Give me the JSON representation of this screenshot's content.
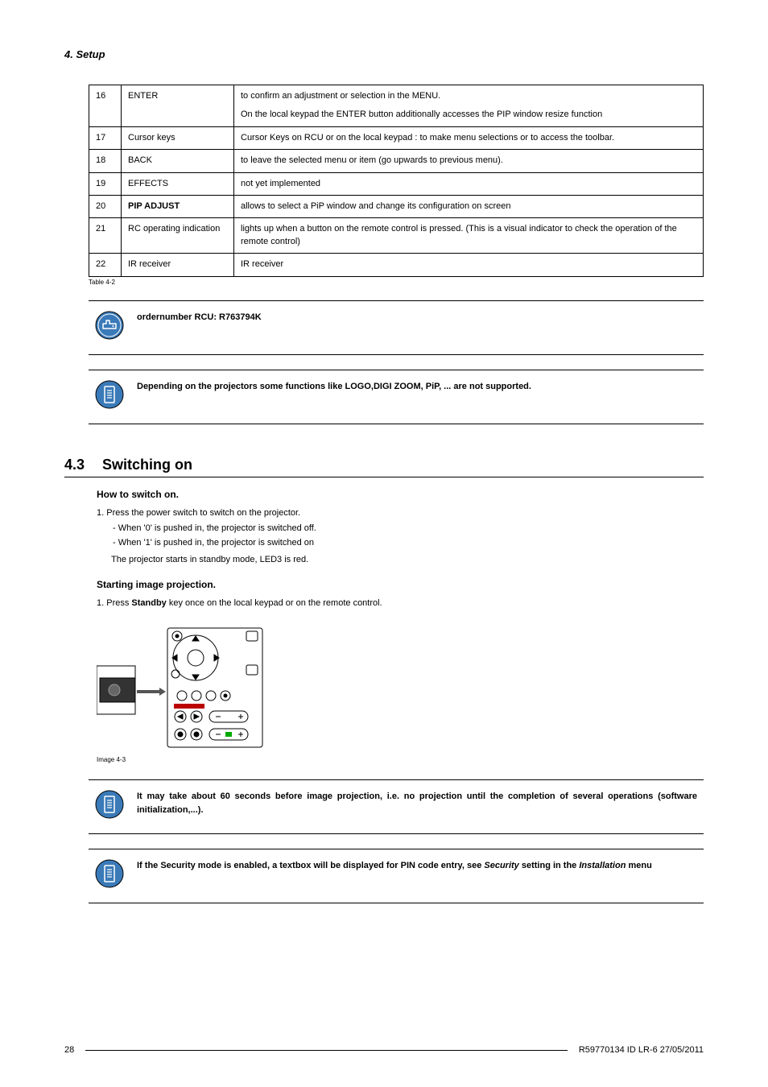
{
  "header": {
    "chapter": "4.  Setup"
  },
  "table": {
    "rows": [
      {
        "num": "16",
        "name": "ENTER",
        "bold": false,
        "desc": "to confirm an adjustment or selection in the MENU.\nOn the local keypad the ENTER button additionally accesses the PIP window resize function"
      },
      {
        "num": "17",
        "name": "Cursor keys",
        "bold": false,
        "desc": "Cursor Keys on RCU or on the local keypad : to make menu selections or to access the toolbar."
      },
      {
        "num": "18",
        "name": "BACK",
        "bold": false,
        "desc": "to leave the selected menu or item (go upwards to previous menu)."
      },
      {
        "num": "19",
        "name": "EFFECTS",
        "bold": false,
        "desc": "not yet implemented"
      },
      {
        "num": "20",
        "name": "PIP ADJUST",
        "bold": true,
        "desc": "allows to select a PiP window and change its configuration on screen"
      },
      {
        "num": "21",
        "name": "RC operating indication",
        "bold": false,
        "desc": "lights up when a button on the remote control is pressed.  (This is a visual indicator to check the operation of the remote control)"
      },
      {
        "num": "22",
        "name": "IR receiver",
        "bold": false,
        "desc": "IR receiver"
      }
    ],
    "caption": "Table 4-2"
  },
  "callouts": {
    "order": "ordernumber RCU: R763794K",
    "unsupported": "Depending on the projectors some functions like LOGO,DIGI ZOOM, PiP, ...  are not supported.",
    "delay": "It may take about 60 seconds before image projection, i.e. no projection until the completion of several operations (software initialization,...).",
    "security_pre": "If the Security mode is enabled, a textbox will be displayed for PIN code entry, see ",
    "security_italic1": "Security",
    "security_mid": " setting in the ",
    "security_italic2": "Installation",
    "security_post": " menu"
  },
  "section": {
    "number": "4.3",
    "title": "Switching on",
    "sub1": "How to switch on.",
    "s1_step1": "1.  Press the power switch to switch on the projector.",
    "s1_sub1": "-   When '0' is pushed in, the projector is switched off.",
    "s1_sub2": "-   When '1' is pushed in, the projector is switched on",
    "s1_note": "The projector starts in standby mode, LED3 is red.",
    "sub2": "Starting image projection.",
    "s2_step1_pre": "1.  Press ",
    "s2_step1_bold": "Standby",
    "s2_step1_post": " key once on the local keypad or on the remote control."
  },
  "image": {
    "caption": "Image 4-3"
  },
  "footer": {
    "page": "28",
    "docid": "R59770134  ID LR-6  27/05/2011"
  }
}
